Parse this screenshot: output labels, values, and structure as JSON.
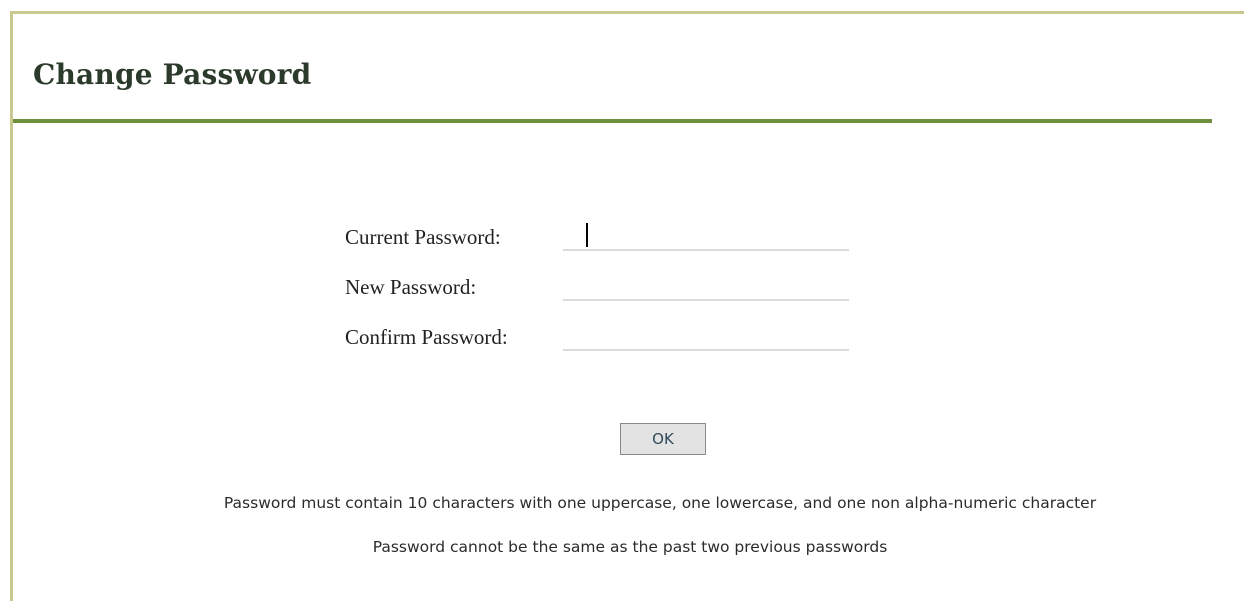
{
  "page": {
    "title": "Change Password"
  },
  "form": {
    "current_password": {
      "label": "Current Password:",
      "value": ""
    },
    "new_password": {
      "label": "New Password:",
      "value": ""
    },
    "confirm_password": {
      "label": "Confirm Password:",
      "value": ""
    },
    "ok_label": "OK"
  },
  "notes": {
    "requirements": "Password must contain 10 characters with one uppercase, one lowercase, and one non alpha-numeric character",
    "history": "Password cannot be the same as the past two previous passwords"
  },
  "colors": {
    "frame_border": "#c9c98f",
    "title_rule": "#6e8f3e",
    "title_text": "#2b3a2b"
  }
}
